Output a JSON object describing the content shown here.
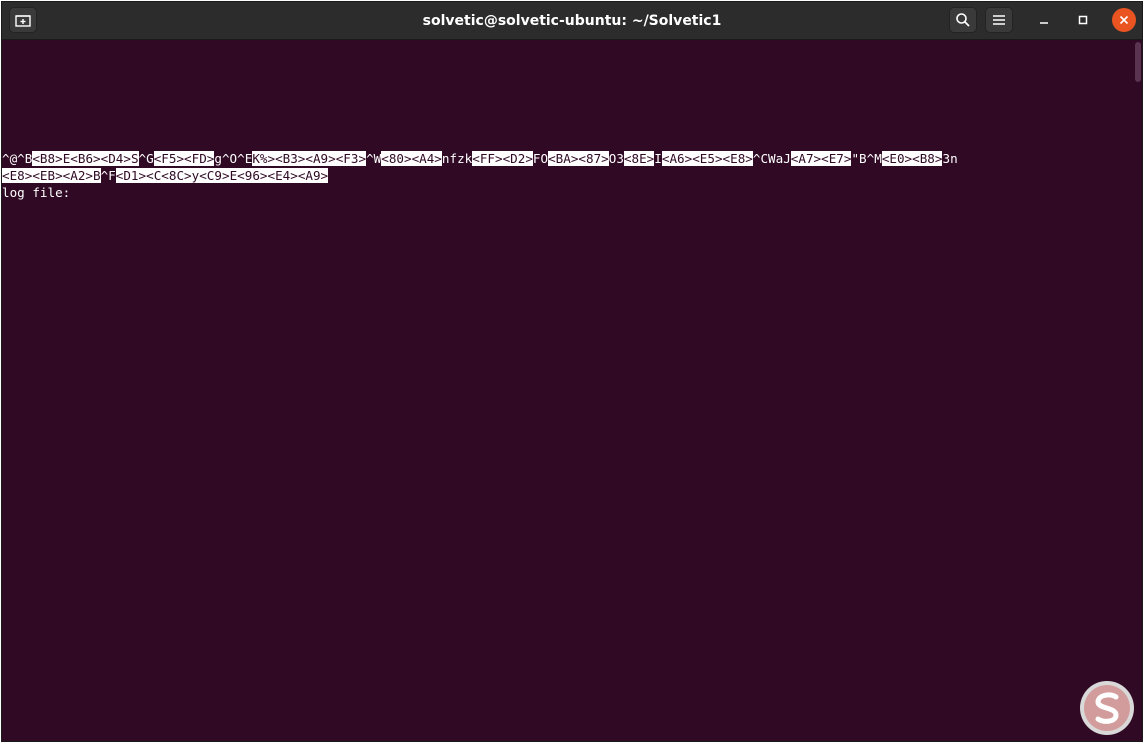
{
  "window": {
    "title": "solvetic@solvetic-ubuntu: ~/Solvetic1",
    "icons": {
      "new_tab": "new-tab-icon",
      "search": "search-icon",
      "menu": "hamburger-menu-icon",
      "minimize": "minimize-icon",
      "maximize": "maximize-icon",
      "close": "close-icon"
    }
  },
  "colors": {
    "terminal_bg": "#300a24",
    "titlebar_bg": "#2c2c2c",
    "close_button": "#e95420",
    "text": "#ffffff"
  },
  "terminal": {
    "line1": [
      {
        "t": "^@^B",
        "h": false
      },
      {
        "t": "<B8>",
        "h": true
      },
      {
        "t": "E",
        "h": true
      },
      {
        "t": "<B6><D4>",
        "h": true
      },
      {
        "t": "S",
        "h": true
      },
      {
        "t": "^G",
        "h": false
      },
      {
        "t": "<F5><FD>",
        "h": true
      },
      {
        "t": "g^O^E",
        "h": false
      },
      {
        "t": "K%>",
        "h": true
      },
      {
        "t": "<B3><A9><F3>",
        "h": true
      },
      {
        "t": "^W",
        "h": false
      },
      {
        "t": "<80><A4>",
        "h": true
      },
      {
        "t": "nfzk",
        "h": false
      },
      {
        "t": "<FF><D2>",
        "h": true
      },
      {
        "t": "FO",
        "h": false
      },
      {
        "t": "<BA><87>",
        "h": true
      },
      {
        "t": "O3",
        "h": false
      },
      {
        "t": "<8E>",
        "h": true
      },
      {
        "t": "I",
        "h": false
      },
      {
        "t": "<A6><E5><E8>",
        "h": true
      },
      {
        "t": "^C",
        "h": false
      },
      {
        "t": "WaJ",
        "h": false
      },
      {
        "t": "<A7><E7>",
        "h": true
      },
      {
        "t": "\"B",
        "h": false
      },
      {
        "t": "^M",
        "h": false
      },
      {
        "t": "<E0><B8>",
        "h": true
      },
      {
        "t": "3n",
        "h": false
      }
    ],
    "line2": [
      {
        "t": "<E8><EB><A2>",
        "h": true
      },
      {
        "t": "B",
        "h": true
      },
      {
        "t": "^F",
        "h": false
      },
      {
        "t": "<D1>",
        "h": true
      },
      {
        "t": "<C",
        "h": true
      },
      {
        "t": "<8C>",
        "h": true
      },
      {
        "t": "y",
        "h": true
      },
      {
        "t": "<C9>",
        "h": true
      },
      {
        "t": "E",
        "h": true
      },
      {
        "t": "<96><E4><A9>",
        "h": true
      }
    ],
    "prompt_line": "log file:"
  },
  "watermark_icon": "solvetic-logo-icon"
}
